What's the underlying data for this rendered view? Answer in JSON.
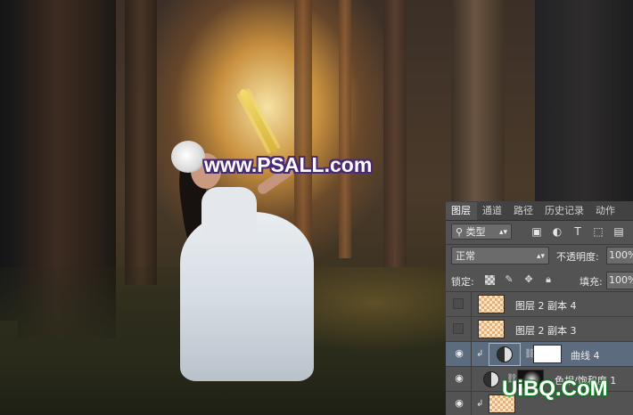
{
  "watermark": "www.PSALL.com",
  "panel": {
    "tabs": [
      {
        "label": "图层",
        "active": true
      },
      {
        "label": "通道",
        "active": false
      },
      {
        "label": "路径",
        "active": false
      },
      {
        "label": "历史记录",
        "active": false
      },
      {
        "label": "动作",
        "active": false
      }
    ],
    "filter_kind": "类型",
    "filter_icons": [
      "image-filter-icon",
      "adjustment-filter-icon",
      "text-filter-icon",
      "shape-filter-icon",
      "smart-object-filter-icon"
    ],
    "blend_mode": "正常",
    "opacity_label": "不透明度:",
    "opacity_value": "100%",
    "lock_label": "锁定:",
    "fill_label": "填充:",
    "fill_value": "100%",
    "layers": [
      {
        "name": "图层 2 副本 4",
        "visible": false
      },
      {
        "name": "图层 2 副本 3",
        "visible": false
      },
      {
        "name": "曲线 4",
        "visible": true,
        "selected": true
      },
      {
        "name": "色相/饱和度 1",
        "visible": true
      },
      {
        "name": "",
        "visible": true
      }
    ]
  },
  "site_logo": {
    "text": "UiBQ.CoM",
    "sub": "色相/饱和度 1"
  },
  "colors": {
    "panel_bg": "#535353",
    "selected_row": "#5d6b7e",
    "watermark_outline": "#4b2a74",
    "logo_outline": "#1a7d2a"
  }
}
